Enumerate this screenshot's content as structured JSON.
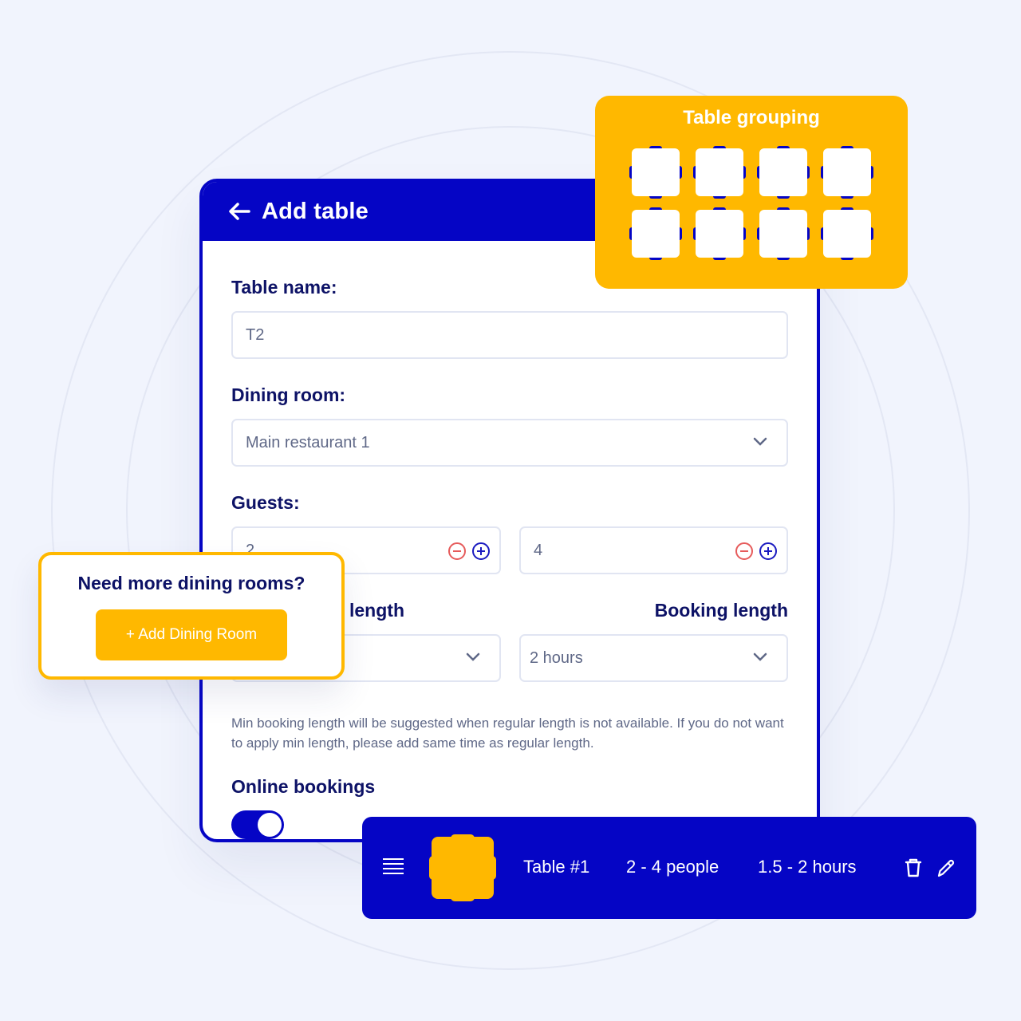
{
  "colors": {
    "brand_blue": "#0505c5",
    "accent_yellow": "#ffb800",
    "heading_text": "#0d1266",
    "muted_text": "#5f6887",
    "minus_red": "#e65b5b"
  },
  "card": {
    "title": "Add table",
    "back_icon": "arrow-left-icon",
    "table_name": {
      "label": "Table name:",
      "value": "T2"
    },
    "dining_room": {
      "label": "Dining room:",
      "value": "Main restaurant 1"
    },
    "guests": {
      "label": "Guests:",
      "min": "2",
      "max": "4"
    },
    "min_booking": {
      "label": "length",
      "value": ""
    },
    "booking": {
      "label": "Booking length",
      "value": "2 hours"
    },
    "hint": "Min booking length will be suggested when regular length is not available. If you do not want to apply min length, please add same time as regular length.",
    "online_bookings": {
      "label": "Online bookings",
      "enabled": true
    }
  },
  "grouping": {
    "title": "Table grouping",
    "tables_count": 8
  },
  "promo": {
    "title": "Need more dining rooms?",
    "button_label": "+ Add Dining Room"
  },
  "row": {
    "name": "Table #1",
    "guests": "2 - 4 people",
    "duration": "1.5 - 2 hours",
    "icons": [
      "menu-icon",
      "trash-icon",
      "pencil-icon"
    ]
  }
}
